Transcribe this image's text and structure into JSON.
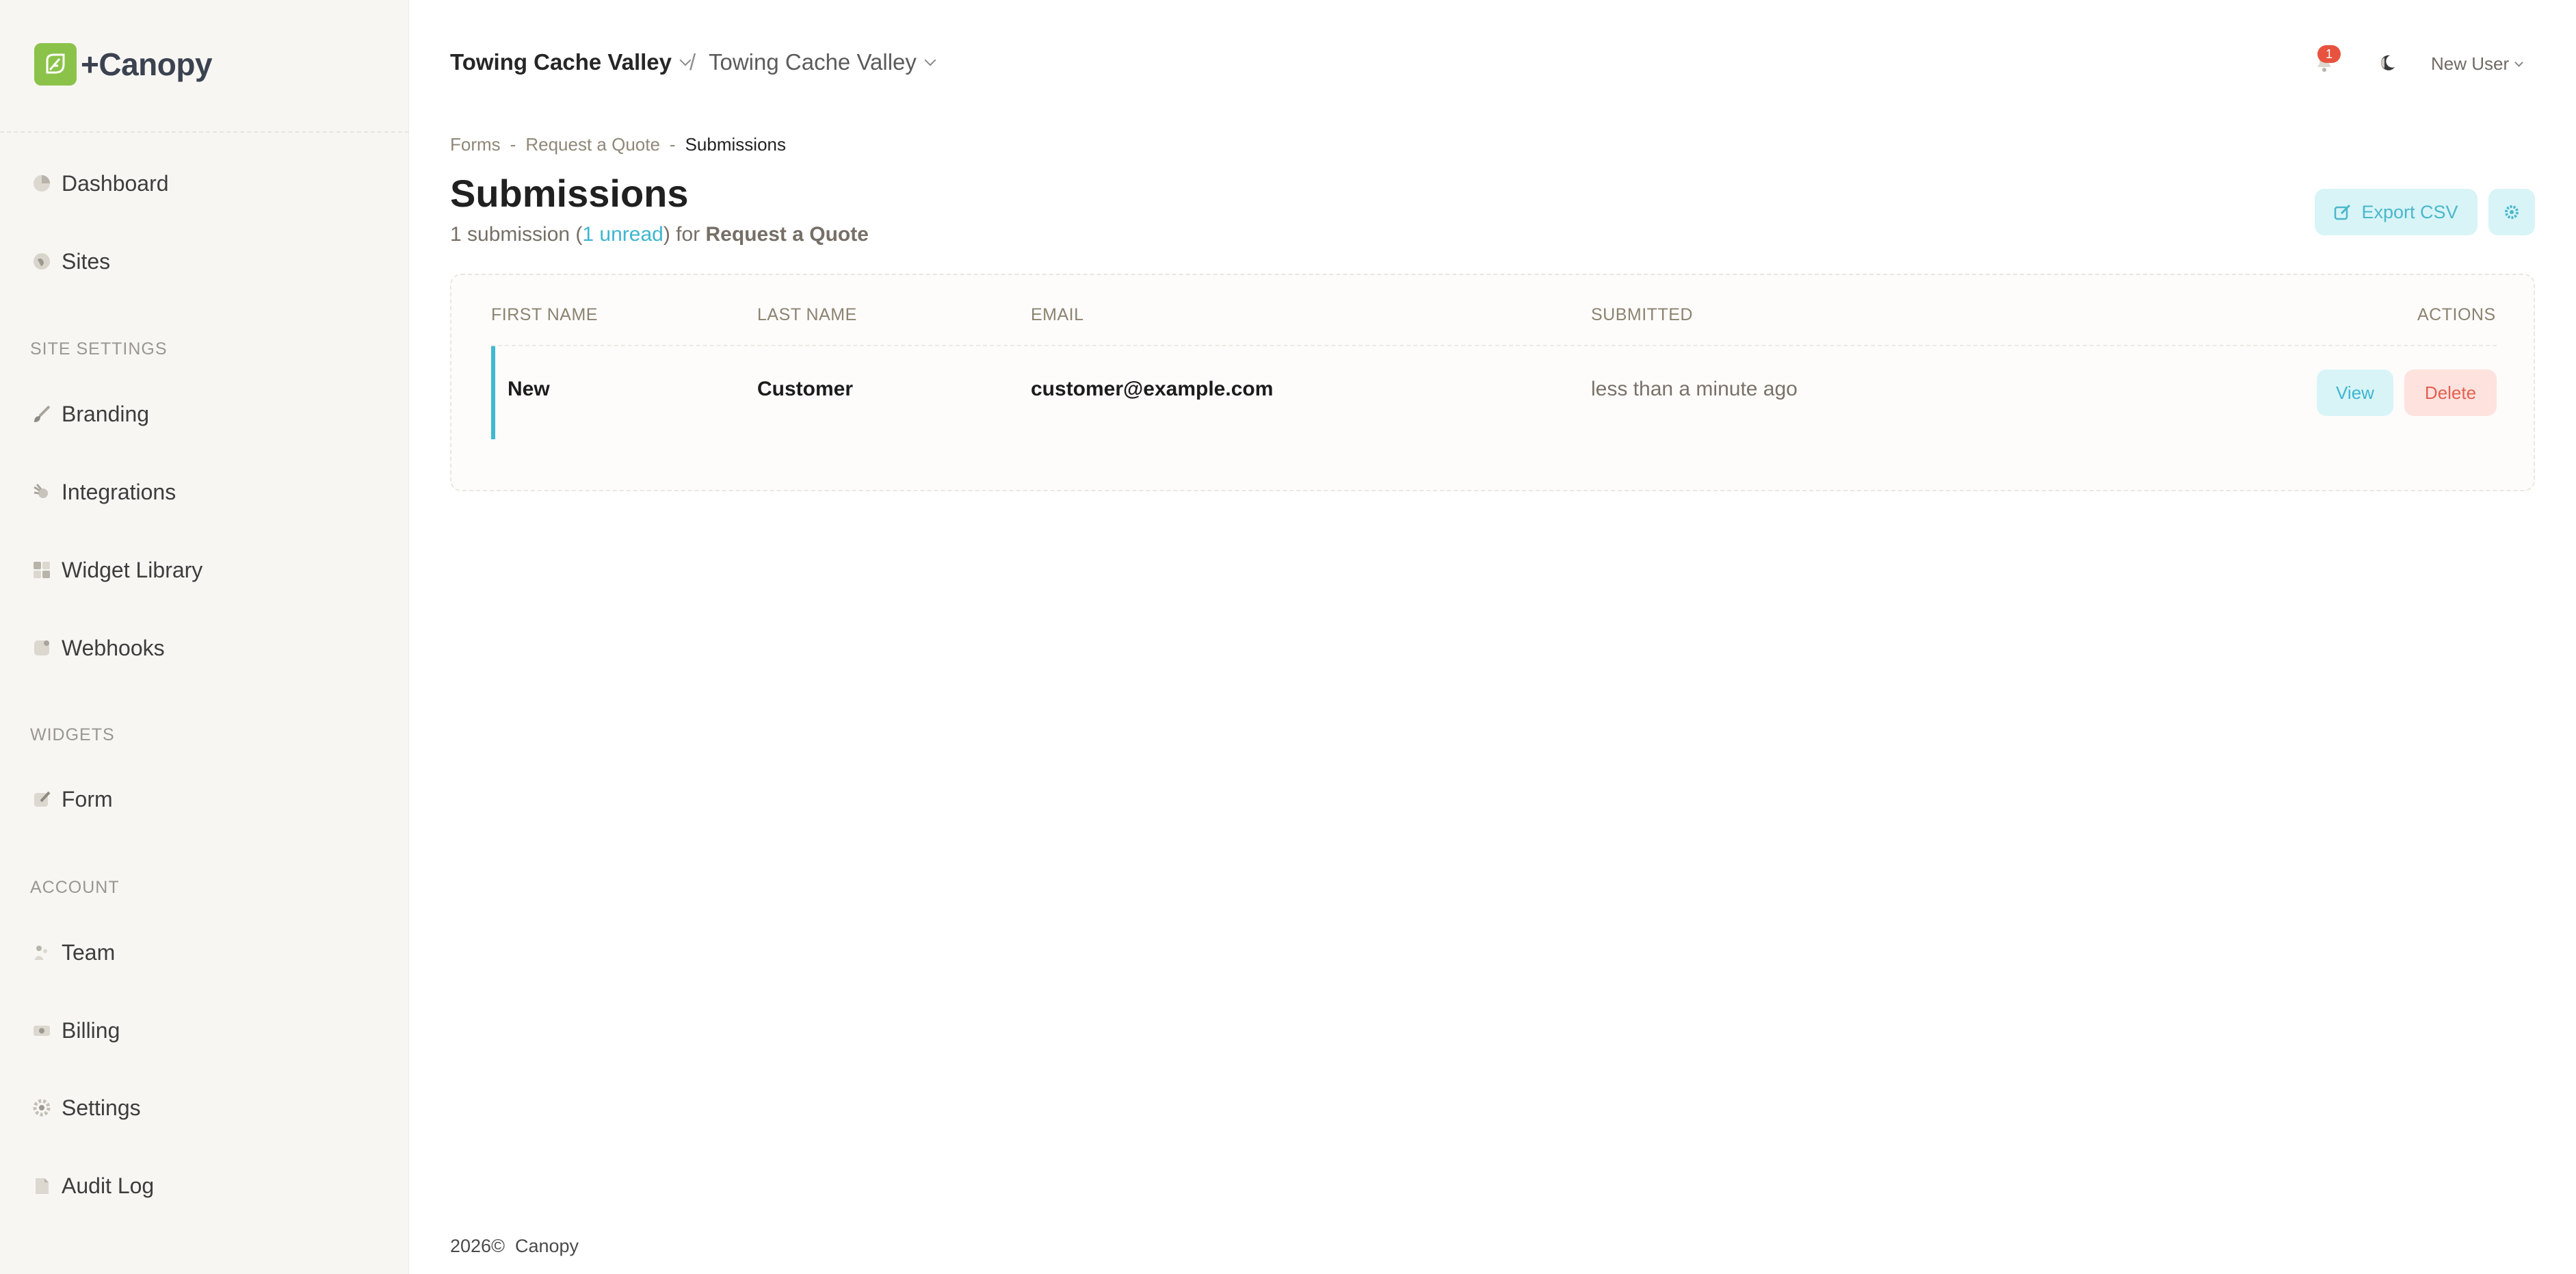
{
  "app": {
    "name": "+Canopy"
  },
  "sidebar": {
    "items_top": [
      {
        "label": "Dashboard",
        "icon": "pie-chart-icon"
      },
      {
        "label": "Sites",
        "icon": "globe-icon"
      }
    ],
    "site_settings_title": "SITE SETTINGS",
    "site_settings": [
      {
        "label": "Branding",
        "icon": "brush-icon"
      },
      {
        "label": "Integrations",
        "icon": "plug-icon"
      },
      {
        "label": "Widget Library",
        "icon": "grid-icon"
      },
      {
        "label": "Webhooks",
        "icon": "webhook-icon"
      }
    ],
    "widgets_title": "WIDGETS",
    "widgets": [
      {
        "label": "Form",
        "icon": "form-icon"
      }
    ],
    "account_title": "ACCOUNT",
    "account": [
      {
        "label": "Team",
        "icon": "team-icon"
      },
      {
        "label": "Billing",
        "icon": "billing-icon"
      },
      {
        "label": "Settings",
        "icon": "gear-icon"
      },
      {
        "label": "Audit Log",
        "icon": "log-icon"
      }
    ]
  },
  "topbar": {
    "org": "Towing Cache Valley",
    "separator": "/",
    "site": "Towing Cache Valley",
    "notification_count": "1",
    "user": "New User"
  },
  "breadcrumb": {
    "items": [
      "Forms",
      "Request a Quote",
      "Submissions"
    ],
    "sep": "-"
  },
  "page": {
    "title": "Submissions",
    "subtitle_count": "1 submission (",
    "subtitle_unread": "1 unread",
    "subtitle_mid": ") for ",
    "subtitle_form": "Request a Quote",
    "export_label": "Export CSV"
  },
  "table": {
    "headers": [
      "FIRST NAME",
      "LAST NAME",
      "EMAIL",
      "SUBMITTED",
      "ACTIONS"
    ],
    "rows": [
      {
        "first": "New",
        "last": "Customer",
        "email": "customer@example.com",
        "submitted": "less than a minute ago",
        "view": "View",
        "delete": "Delete"
      }
    ]
  },
  "footer": {
    "year": "2026©",
    "brand": "Canopy"
  },
  "colors": {
    "accent": "#3eb6d0",
    "danger": "#e3604f",
    "brand": "#8bc34a",
    "sidebar_bg": "#f7f6f3"
  }
}
